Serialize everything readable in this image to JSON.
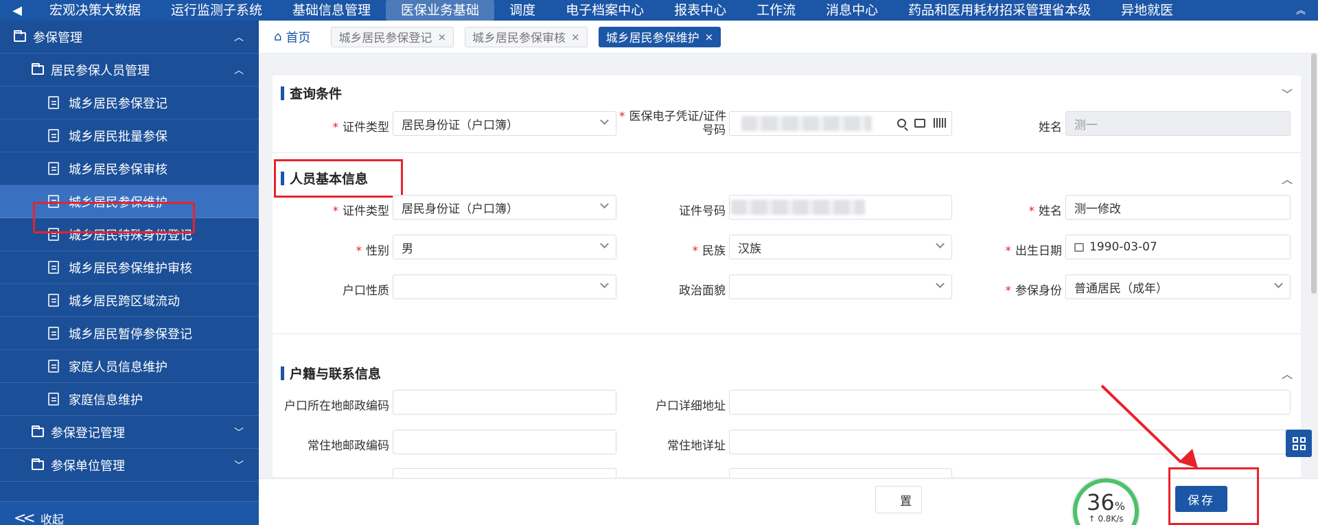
{
  "topnav": {
    "items": [
      "宏观决策大数据",
      "运行监测子系统",
      "基础信息管理",
      "医保业务基础",
      "调度",
      "电子档案中心",
      "报表中心",
      "工作流",
      "消息中心",
      "药品和医用耗材招采管理省本级",
      "异地就医"
    ],
    "active_index": 3
  },
  "sidebar": {
    "root": "参保管理",
    "group": "居民参保人员管理",
    "items": [
      "城乡居民参保登记",
      "城乡居民批量参保",
      "城乡居民参保审核",
      "城乡居民参保维护",
      "城乡居民特殊身份登记",
      "城乡居民参保维护审核",
      "城乡居民跨区域流动",
      "城乡居民暂停参保登记",
      "家庭人员信息维护",
      "家庭信息维护"
    ],
    "active_index": 3,
    "other_groups": [
      "参保登记管理",
      "参保单位管理"
    ],
    "collapse_label": "收起"
  },
  "tabs": {
    "home": "首页",
    "items": [
      "城乡居民参保登记",
      "城乡居民参保审核",
      "城乡居民参保维护"
    ],
    "active_index": 2
  },
  "query": {
    "title": "查询条件",
    "id_type_label": "证件类型",
    "id_type_value": "居民身份证（户口簿）",
    "voucher_label_line1": "医保电子凭证/证件",
    "voucher_label_line2": "号码",
    "name_label": "姓名",
    "name_value": "测一"
  },
  "basic": {
    "title": "人员基本信息",
    "id_type_label": "证件类型",
    "id_type_value": "居民身份证（户口簿）",
    "id_no_label": "证件号码",
    "name_label": "姓名",
    "name_value": "测一修改",
    "gender_label": "性别",
    "gender_value": "男",
    "ethnic_label": "民族",
    "ethnic_value": "汉族",
    "birth_label": "出生日期",
    "birth_value": "1990-03-07",
    "hukou_type_label": "户口性质",
    "political_label": "政治面貌",
    "insured_identity_label": "参保身份",
    "insured_identity_value": "普通居民（成年）"
  },
  "contact": {
    "title": "户籍与联系信息",
    "hukou_zip_label": "户口所在地邮政编码",
    "hukou_addr_label": "户口详细地址",
    "res_zip_label": "常住地邮政编码",
    "res_addr_label": "常住地详址"
  },
  "actions": {
    "reset_label": "置",
    "save_label": "保存"
  },
  "speed": {
    "percent": "36",
    "percent_unit": "%",
    "rate": "0.8K/s"
  },
  "colors": {
    "primary": "#1c56a6",
    "sidebar": "#1b4f98",
    "annotation": "#e8222b",
    "progress": "#4cc26a"
  }
}
